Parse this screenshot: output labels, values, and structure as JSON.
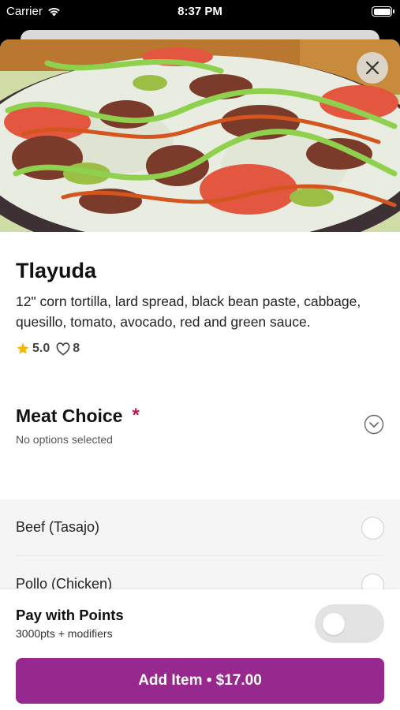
{
  "status_bar": {
    "carrier": "Carrier",
    "time": "8:37 PM"
  },
  "item": {
    "title": "Tlayuda",
    "description": "12\" corn tortilla, lard spread, black bean paste, cabbage, quesillo, tomato, avocado, red and green sauce.",
    "rating": "5.0",
    "likes": "8"
  },
  "modifier_group": {
    "title": "Meat Choice",
    "required_marker": "*",
    "selection_status": "No options selected",
    "options": [
      {
        "label": "Beef (Tasajo)"
      },
      {
        "label": "Pollo (Chicken)"
      }
    ]
  },
  "points": {
    "title": "Pay with Points",
    "subtitle": "3000pts + modifiers",
    "toggle_on": false
  },
  "cta": {
    "label": "Add Item • $17.00"
  },
  "colors": {
    "accent": "#96288e",
    "required": "#c2185b",
    "star": "#f5b800"
  },
  "icons": [
    "wifi-icon",
    "battery-icon",
    "close-icon",
    "star-icon",
    "heart-icon",
    "chevron-down-icon"
  ]
}
